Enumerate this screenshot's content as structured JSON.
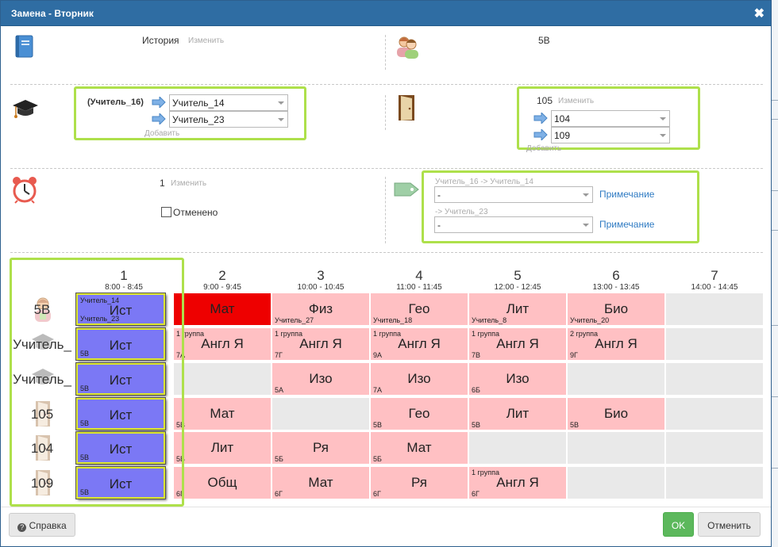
{
  "dialog": {
    "title": "Замена - Вторник",
    "close_glyph": "✖"
  },
  "subject": {
    "value": "История",
    "change": "Изменить"
  },
  "class_value": "5В",
  "teachers": {
    "original": "(Учитель_16)",
    "replacements": [
      "Учитель_14",
      "Учитель_23"
    ],
    "add": "Добавить"
  },
  "rooms": {
    "original": "105",
    "change": "Изменить",
    "replacements": [
      "104",
      "109"
    ],
    "add": "Добавить"
  },
  "lesson": {
    "value": "1",
    "change": "Изменить",
    "cancelled_label": "Отменено"
  },
  "notes": [
    {
      "label": "Учитель_16 -> Учитель_14",
      "value": "-",
      "link": "Примечание"
    },
    {
      "label": "-> Учитель_23",
      "value": "-",
      "link": "Примечание"
    }
  ],
  "schedule": {
    "columns": [
      {
        "n": "1",
        "time": "8:00 - 8:45"
      },
      {
        "n": "2",
        "time": "9:00 - 9:45"
      },
      {
        "n": "3",
        "time": "10:00 - 10:45"
      },
      {
        "n": "4",
        "time": "11:00 - 11:45"
      },
      {
        "n": "5",
        "time": "12:00 - 12:45"
      },
      {
        "n": "6",
        "time": "13:00 - 13:45"
      },
      {
        "n": "7",
        "time": "14:00 - 14:45"
      }
    ],
    "rows": [
      {
        "label": "5В",
        "icon": "student-icon",
        "cells": [
          {
            "style": "blue",
            "subject": "Ист",
            "top": "Учитель_14",
            "bottom": "Учитель_23"
          },
          {
            "style": "red",
            "subject": "Мат",
            "top": "",
            "bottom": ""
          },
          {
            "style": "pink",
            "subject": "Физ",
            "top": "",
            "bottom": "Учитель_27"
          },
          {
            "style": "pink",
            "subject": "Гео",
            "top": "",
            "bottom": "Учитель_18"
          },
          {
            "style": "pink",
            "subject": "Лит",
            "top": "",
            "bottom": "Учитель_8"
          },
          {
            "style": "pink",
            "subject": "Био",
            "top": "",
            "bottom": "Учитель_20"
          },
          {
            "style": "empty",
            "subject": "",
            "top": "",
            "bottom": ""
          }
        ]
      },
      {
        "label": "Учитель_",
        "icon": "graduation-cap-icon",
        "cells": [
          {
            "style": "blue",
            "subject": "Ист",
            "top": "",
            "bottom": "5В"
          },
          {
            "style": "pink",
            "subject": "Англ Я",
            "top": "1 группа",
            "bottom": "7А"
          },
          {
            "style": "pink",
            "subject": "Англ Я",
            "top": "1 группа",
            "bottom": "7Г"
          },
          {
            "style": "pink",
            "subject": "Англ Я",
            "top": "1 группа",
            "bottom": "9А"
          },
          {
            "style": "pink",
            "subject": "Англ Я",
            "top": "1 группа",
            "bottom": "7В"
          },
          {
            "style": "pink",
            "subject": "Англ Я",
            "top": "2 группа",
            "bottom": "9Г"
          },
          {
            "style": "empty",
            "subject": "",
            "top": "",
            "bottom": ""
          }
        ]
      },
      {
        "label": "Учитель_",
        "icon": "graduation-cap-icon",
        "cells": [
          {
            "style": "blue",
            "subject": "Ист",
            "top": "",
            "bottom": "5В"
          },
          {
            "style": "empty",
            "subject": "",
            "top": "",
            "bottom": ""
          },
          {
            "style": "pink",
            "subject": "Изо",
            "top": "",
            "bottom": "5А"
          },
          {
            "style": "pink",
            "subject": "Изо",
            "top": "",
            "bottom": "7А"
          },
          {
            "style": "pink",
            "subject": "Изо",
            "top": "",
            "bottom": "6Б"
          },
          {
            "style": "empty",
            "subject": "",
            "top": "",
            "bottom": ""
          },
          {
            "style": "empty",
            "subject": "",
            "top": "",
            "bottom": ""
          }
        ]
      },
      {
        "label": "105",
        "icon": "door-icon",
        "cells": [
          {
            "style": "blue",
            "subject": "Ист",
            "top": "",
            "bottom": "5В"
          },
          {
            "style": "pink",
            "subject": "Мат",
            "top": "",
            "bottom": "5В"
          },
          {
            "style": "empty",
            "subject": "",
            "top": "",
            "bottom": ""
          },
          {
            "style": "pink",
            "subject": "Гео",
            "top": "",
            "bottom": "5В"
          },
          {
            "style": "pink",
            "subject": "Лит",
            "top": "",
            "bottom": "5В"
          },
          {
            "style": "pink",
            "subject": "Био",
            "top": "",
            "bottom": "5В"
          },
          {
            "style": "empty",
            "subject": "",
            "top": "",
            "bottom": ""
          }
        ]
      },
      {
        "label": "104",
        "icon": "door-icon",
        "cells": [
          {
            "style": "blue",
            "subject": "Ист",
            "top": "",
            "bottom": "5В"
          },
          {
            "style": "pink",
            "subject": "Лит",
            "top": "",
            "bottom": "5Б"
          },
          {
            "style": "pink",
            "subject": "Ря",
            "top": "",
            "bottom": "5Б"
          },
          {
            "style": "pink",
            "subject": "Мат",
            "top": "",
            "bottom": "5Б"
          },
          {
            "style": "empty",
            "subject": "",
            "top": "",
            "bottom": ""
          },
          {
            "style": "empty",
            "subject": "",
            "top": "",
            "bottom": ""
          },
          {
            "style": "empty",
            "subject": "",
            "top": "",
            "bottom": ""
          }
        ]
      },
      {
        "label": "109",
        "icon": "door-icon",
        "cells": [
          {
            "style": "blue",
            "subject": "Ист",
            "top": "",
            "bottom": "5В"
          },
          {
            "style": "pink",
            "subject": "Общ",
            "top": "",
            "bottom": "6Г"
          },
          {
            "style": "pink",
            "subject": "Мат",
            "top": "",
            "bottom": "6Г"
          },
          {
            "style": "pink",
            "subject": "Ря",
            "top": "",
            "bottom": "6Г"
          },
          {
            "style": "pink",
            "subject": "Англ Я",
            "top": "1 группа",
            "bottom": "6Г"
          },
          {
            "style": "empty",
            "subject": "",
            "top": "",
            "bottom": ""
          },
          {
            "style": "empty",
            "subject": "",
            "top": "",
            "bottom": ""
          }
        ]
      }
    ]
  },
  "footer": {
    "help": "Справка",
    "ok": "OK",
    "cancel": "Отменить"
  },
  "colors": {
    "title_bar": "#2f6da3",
    "highlight": "#aee04b",
    "lesson_pink": "#ffc0c3",
    "lesson_red": "#ee0000",
    "lesson_selected": "#7b78f5",
    "ok": "#5cb85c"
  }
}
